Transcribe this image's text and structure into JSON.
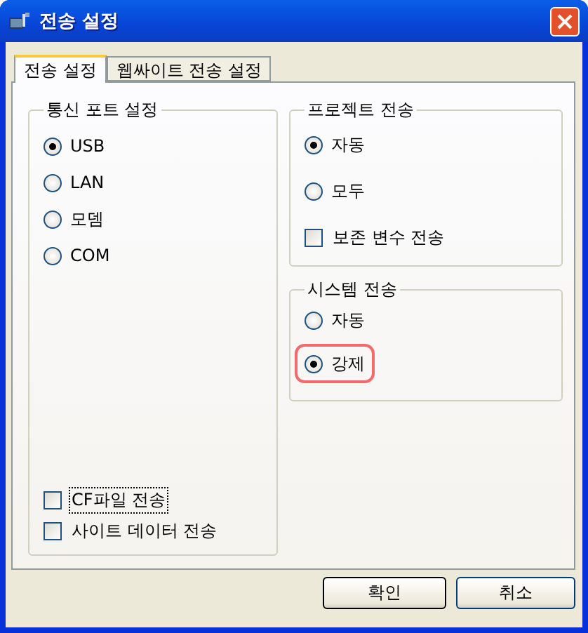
{
  "window": {
    "title": "전송 설정"
  },
  "tabs": [
    {
      "label": "전송 설정",
      "selected": true
    },
    {
      "label": "웹싸이트 전송 설정",
      "selected": false
    }
  ],
  "port_group": {
    "title": "통신 포트 설정",
    "options": [
      {
        "label": "USB",
        "selected": true
      },
      {
        "label": "LAN",
        "selected": false
      },
      {
        "label": "모뎀",
        "selected": false
      },
      {
        "label": "COM",
        "selected": false
      }
    ],
    "checks": [
      {
        "label": "CF파일 전송",
        "checked": false,
        "focused": true
      },
      {
        "label": "사이트 데이터 전송",
        "checked": false,
        "focused": false
      }
    ]
  },
  "project_group": {
    "title": "프로젝트 전송",
    "options": [
      {
        "label": "자동",
        "selected": true
      },
      {
        "label": "모두",
        "selected": false
      }
    ],
    "checks": [
      {
        "label": "보존 변수 전송",
        "checked": false
      }
    ]
  },
  "system_group": {
    "title": "시스템 전송",
    "options": [
      {
        "label": "자동",
        "selected": false,
        "highlighted": false
      },
      {
        "label": "강제",
        "selected": true,
        "highlighted": true
      }
    ]
  },
  "buttons": [
    {
      "label": "확인",
      "default": true
    },
    {
      "label": "취소",
      "default": false
    }
  ]
}
